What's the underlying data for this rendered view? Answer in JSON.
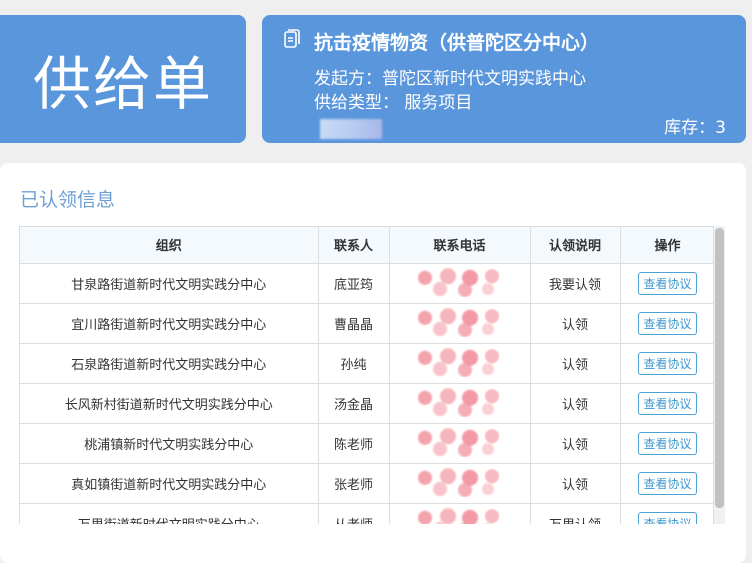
{
  "header": {
    "badge": "供给单",
    "title": "抗击疫情物资（供普陀区分中心）",
    "initiator": "发起方：普陀区新时代文明实践中心",
    "supply_type": "供给类型： 服务项目",
    "stock": "库存：3",
    "icon": "document-icon"
  },
  "section": {
    "title": "已认领信息"
  },
  "table": {
    "columns": [
      "组织",
      "联系人",
      "联系电话",
      "认领说明",
      "操作"
    ],
    "rows": [
      {
        "org": "甘泉路街道新时代文明实践分中心",
        "contact": "底亚筠",
        "note": "我要认领",
        "action": "查看协议"
      },
      {
        "org": "宜川路街道新时代文明实践分中心",
        "contact": "曹晶晶",
        "note": "认领",
        "action": "查看协议"
      },
      {
        "org": "石泉路街道新时代文明实践分中心",
        "contact": "孙纯",
        "note": "认领",
        "action": "查看协议"
      },
      {
        "org": "长风新村街道新时代文明实践分中心",
        "contact": "汤金晶",
        "note": "认领",
        "action": "查看协议"
      },
      {
        "org": "桃浦镇新时代文明实践分中心",
        "contact": "陈老师",
        "note": "认领",
        "action": "查看协议"
      },
      {
        "org": "真如镇街道新时代文明实践分中心",
        "contact": "张老师",
        "note": "认领",
        "action": "查看协议"
      },
      {
        "org": "万里街道新时代文明实践分中心",
        "contact": "从老师",
        "note": "万里认领",
        "action": "查看协议"
      }
    ]
  },
  "colors": {
    "accent": "#5a96dc",
    "section_title": "#6e9fd4",
    "button": "#3d97d0"
  }
}
